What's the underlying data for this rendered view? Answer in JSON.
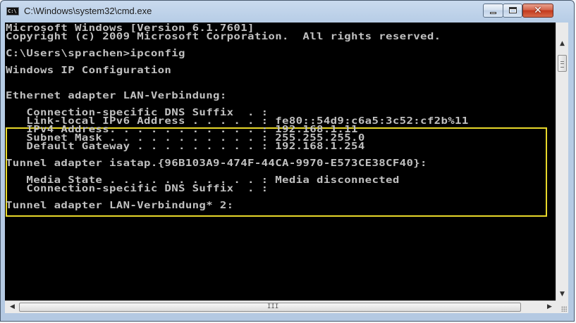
{
  "window": {
    "title": "C:\\Windows\\system32\\cmd.exe",
    "icon_label": "C:\\"
  },
  "caption_buttons": {
    "close_glyph": "✕"
  },
  "console": {
    "lines": [
      "Microsoft Windows [Version 6.1.7601]",
      "Copyright (c) 2009 Microsoft Corporation.  All rights reserved.",
      "",
      "C:\\Users\\sprachen>ipconfig",
      "",
      "Windows IP Configuration",
      "",
      "",
      "Ethernet adapter LAN-Verbindung:",
      "",
      "   Connection-specific DNS Suffix  . :",
      "   Link-local IPv6 Address . . . . . : fe80::54d9:c6a5:3c52:cf2b%11",
      "   IPv4 Address. . . . . . . . . . . : 192.168.1.11",
      "   Subnet Mask . . . . . . . . . . . : 255.255.255.0",
      "   Default Gateway . . . . . . . . . : 192.168.1.254",
      "",
      "Tunnel adapter isatap.{96B103A9-474F-44CA-9970-E573CE38CF40}:",
      "",
      "   Media State . . . . . . . . . . . : Media disconnected",
      "   Connection-specific DNS Suffix  . :",
      "",
      "Tunnel adapter LAN-Verbindung* 2:"
    ],
    "text_color": "#c0c0c0",
    "background_color": "#000000",
    "highlight_color": "#e8d82a"
  },
  "scrollbars": {
    "up_arrow": "▲",
    "down_arrow": "▼",
    "left_arrow": "◀",
    "right_arrow": "▶",
    "h_grip": "III"
  }
}
